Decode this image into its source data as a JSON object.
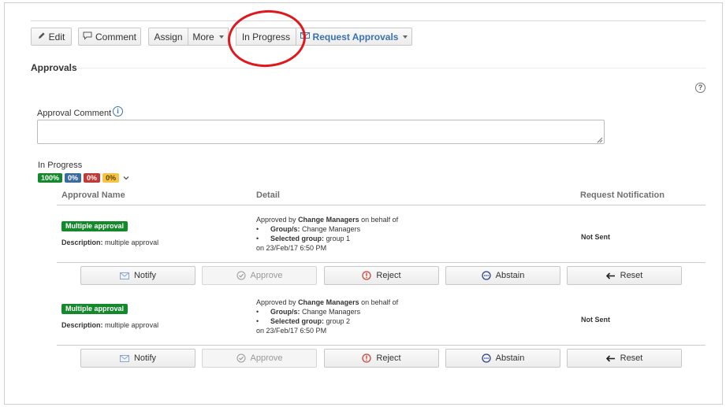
{
  "toolbar": {
    "edit_label": "Edit",
    "comment_label": "Comment",
    "assign_label": "Assign",
    "more_label": "More",
    "in_progress_label": "In Progress",
    "request_approvals_label": "Request Approvals"
  },
  "approvals": {
    "section_title": "Approvals",
    "comment_label": "Approval Comment",
    "comment_value": "",
    "status_text": "In Progress",
    "badges": [
      "100%",
      "0%",
      "0%",
      "0%"
    ],
    "headers": {
      "name": "Approval Name",
      "detail": "Detail",
      "notification": "Request Notification"
    },
    "rows": [
      {
        "name": "Multiple approval",
        "description_label": "Description:",
        "description_value": "multiple approval",
        "detail_prefix": "Approved by",
        "detail_approver": "Change Managers",
        "detail_suffix": "on behalf of",
        "groups_label": "Group/s:",
        "groups_value": "Change Managers",
        "selected_label": "Selected group:",
        "selected_value": "group 1",
        "date_line": "on 23/Feb/17 6:50 PM",
        "notification": "Not Sent"
      },
      {
        "name": "Multiple approval",
        "description_label": "Description:",
        "description_value": "multiple approval",
        "detail_prefix": "Approved by",
        "detail_approver": "Change Managers",
        "detail_suffix": "on behalf of",
        "groups_label": "Group/s:",
        "groups_value": "Change Managers",
        "selected_label": "Selected group:",
        "selected_value": "group 2",
        "date_line": "on 23/Feb/17 6:50 PM",
        "notification": "Not Sent"
      }
    ],
    "actions": {
      "notify": "Notify",
      "approve": "Approve",
      "reject": "Reject",
      "abstain": "Abstain",
      "reset": "Reset"
    }
  },
  "colors": {
    "success": "#14892c",
    "link": "#3b73af",
    "error": "#d04437",
    "annotation": "#e0171d"
  }
}
